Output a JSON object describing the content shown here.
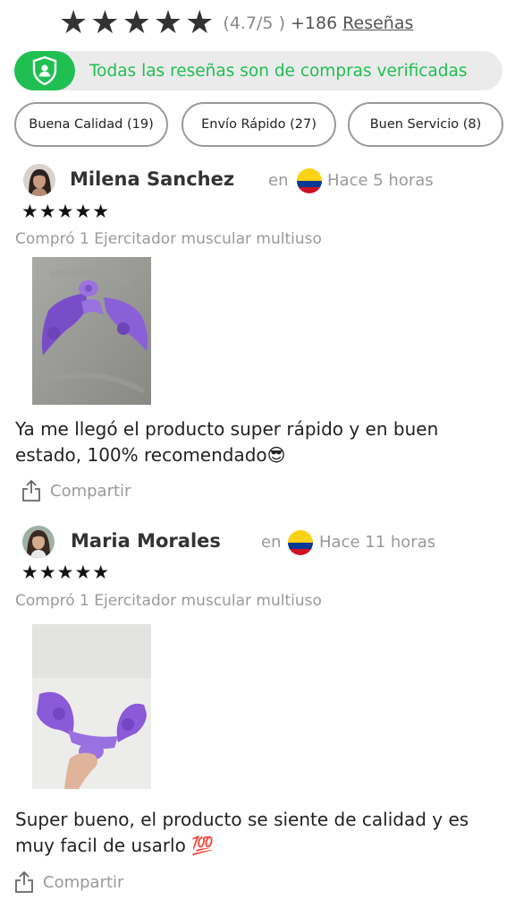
{
  "summary": {
    "star_glyph": "★",
    "star_count": 5,
    "score": "(4.7/5 )",
    "count": "+186",
    "reviews_link": "Reseñas"
  },
  "verified": {
    "text": "Todas las reseñas son de compras verificadas",
    "icon": "shield-user-icon"
  },
  "filters": [
    {
      "label": "Buena Calidad (19)"
    },
    {
      "label": "Envío Rápido (27)"
    },
    {
      "label": "Buen Servicio (8)"
    }
  ],
  "reviews": [
    {
      "author": "Milena Sanchez",
      "country_prefix": "en",
      "country_flag": "colombia-flag",
      "time": "Hace 5 horas",
      "stars": "★★★★★",
      "purchased": "Compró 1 Ejercitador muscular multiuso",
      "text": "Ya me llegó el producto super rápido y en buen estado, 100% recomendado😎",
      "share_label": "Compartir"
    },
    {
      "author": "Maria Morales",
      "country_prefix": "en",
      "country_flag": "colombia-flag",
      "time": "Hace 11 horas",
      "stars": "★★★★★",
      "purchased": "Compró 1 Ejercitador muscular multiuso",
      "text": "Super bueno, el producto se siente de calidad y es muy facil de usarlo 💯",
      "share_label": "Compartir"
    }
  ],
  "colors": {
    "accent": "#1fbf52",
    "chip_border": "#9a9a9a",
    "muted": "#999999"
  }
}
